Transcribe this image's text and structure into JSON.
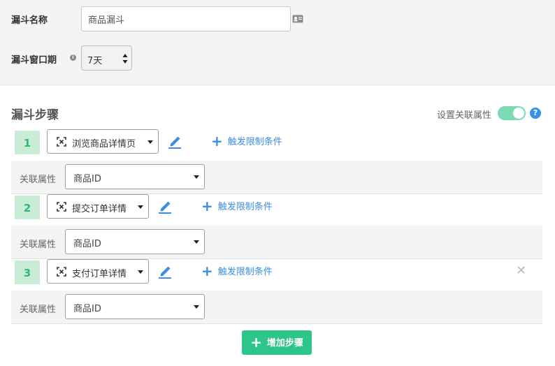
{
  "form": {
    "funnel_name_label": "漏斗名称",
    "funnel_name_value": "商品漏斗",
    "window_label": "漏斗窗口期",
    "window_info_icon": "info-icon",
    "window_value": "7天"
  },
  "steps_section": {
    "title": "漏斗步骤",
    "relation_toggle_label": "设置关联属性",
    "relation_toggle_on": true,
    "help_icon": "question-circle-icon",
    "help_glyph": "?"
  },
  "steps": [
    {
      "number": "1",
      "event": "浏览商品详情页",
      "trigger_label": "触发限制条件",
      "relation_label": "关联属性",
      "relation_value": "商品ID",
      "removable": false
    },
    {
      "number": "2",
      "event": "提交订单详情",
      "trigger_label": "触发限制条件",
      "relation_label": "关联属性",
      "relation_value": "商品ID",
      "removable": false
    },
    {
      "number": "3",
      "event": "支付订单详情",
      "trigger_label": "触发限制条件",
      "relation_label": "关联属性",
      "relation_value": "商品ID",
      "removable": true
    }
  ],
  "symbols": {
    "plus": "+",
    "close": "✕",
    "info": "i"
  },
  "add_step_label": "增加步骤",
  "colors": {
    "accent_green": "#2ec58b",
    "step_badge_bg": "#c9ecd6",
    "step_badge_text": "#2fb873",
    "link_blue": "#3c8ee5",
    "toggle_on": "#7dd9b1"
  }
}
